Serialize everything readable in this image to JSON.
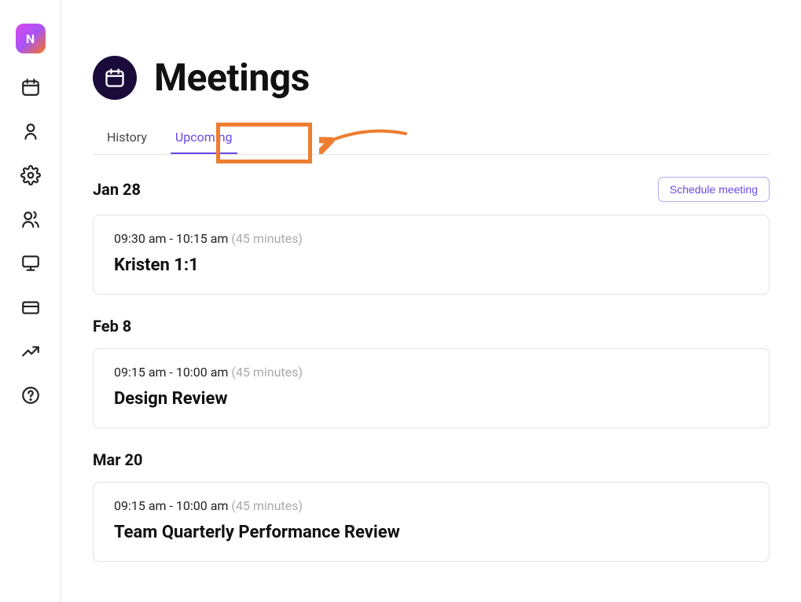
{
  "logo_text": "N",
  "header": {
    "title": "Meetings"
  },
  "tabs": {
    "history": "History",
    "upcoming": "Upcoming"
  },
  "schedule_button": "Schedule meeting",
  "days": [
    {
      "date": "Jan 28",
      "meeting": {
        "time": "09:30 am - 10:15 am",
        "duration": "(45 minutes)",
        "title": "Kristen 1:1"
      },
      "show_schedule": true
    },
    {
      "date": "Feb 8",
      "meeting": {
        "time": "09:15 am - 10:00 am",
        "duration": "(45 minutes)",
        "title": "Design Review"
      },
      "show_schedule": false
    },
    {
      "date": "Mar 20",
      "meeting": {
        "time": "09:15 am - 10:00 am",
        "duration": "(45 minutes)",
        "title": "Team Quarterly Performance Review"
      },
      "show_schedule": false
    }
  ]
}
